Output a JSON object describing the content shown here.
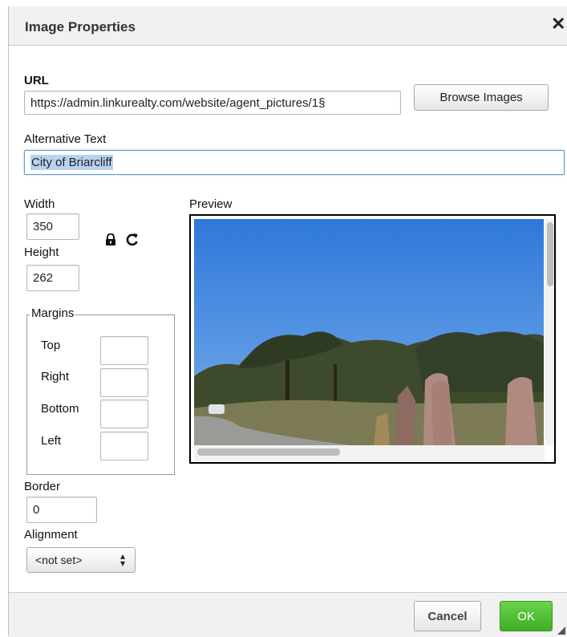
{
  "dialog": {
    "title": "Image Properties",
    "close_glyph": "✕"
  },
  "url": {
    "label": "URL",
    "value": "https://admin.linkurealty.com/website/agent_pictures/1§",
    "browse_label": "Browse Images"
  },
  "alt": {
    "label": "Alternative Text",
    "value": "City of Briarcliff"
  },
  "size": {
    "width_label": "Width",
    "width_value": "350",
    "height_label": "Height",
    "height_value": "262",
    "lock_icon": "lock-icon",
    "reset_icon": "reset-icon"
  },
  "margins": {
    "legend": "Margins",
    "top_label": "Top",
    "right_label": "Right",
    "bottom_label": "Bottom",
    "left_label": "Left",
    "top_value": "",
    "right_value": "",
    "bottom_value": "",
    "left_value": ""
  },
  "border": {
    "label": "Border",
    "value": "0"
  },
  "alignment": {
    "label": "Alignment",
    "value": "<not set>"
  },
  "preview": {
    "label": "Preview"
  },
  "footer": {
    "cancel_label": "Cancel",
    "ok_label": "OK"
  },
  "colors": {
    "ok_button": "#4cbd33",
    "focus_border": "#5b9bd5",
    "sky": "#3f86e0"
  }
}
